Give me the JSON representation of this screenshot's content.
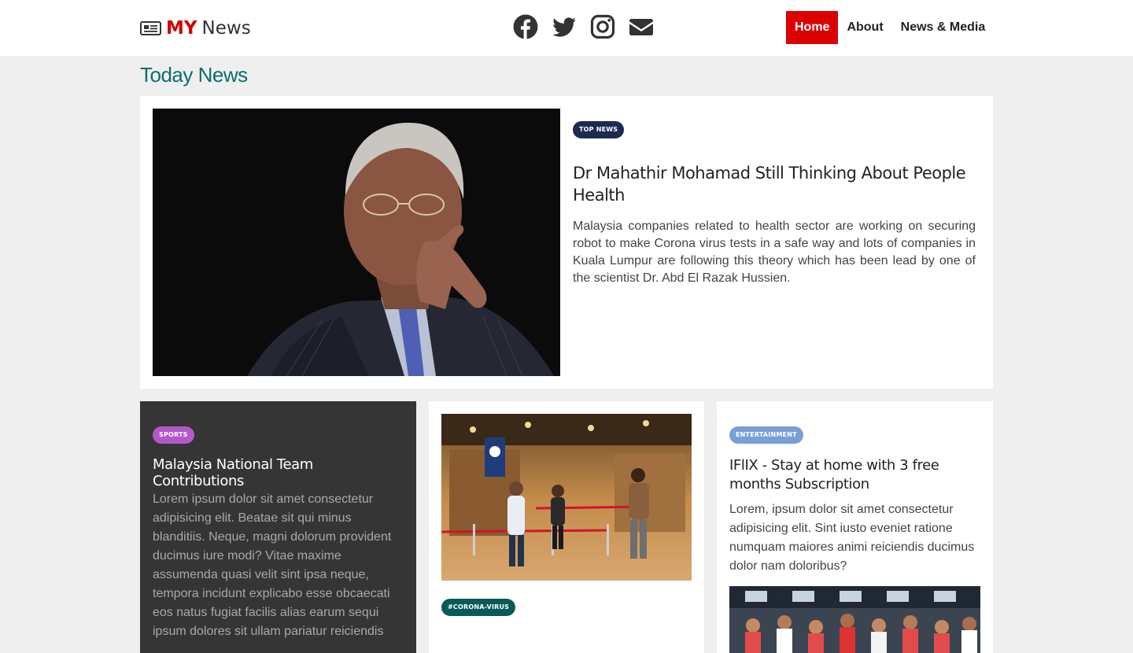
{
  "header": {
    "brand_my": "MY",
    "brand_news": "News",
    "socials": [
      "facebook-icon",
      "twitter-icon",
      "instagram-icon",
      "envelope-icon"
    ],
    "nav": [
      {
        "label": "Home",
        "active": true
      },
      {
        "label": "About",
        "active": false
      },
      {
        "label": "News & Media",
        "active": false
      }
    ]
  },
  "section_title": "Today News",
  "featured": {
    "badge": "TOP NEWS",
    "title": "Dr Mahathir Mohamad Still Thinking About People Health",
    "text": "Malaysia companies related to health sector are working on securing robot to make Corona virus tests in a safe way and lots of companies in Kuala Lumpur are following this theory which has been lead by one of the scientist Dr. Abd El Razak Hussien."
  },
  "cards": {
    "sports": {
      "badge": "SPORTS",
      "title": "Malaysia National Team Contributions",
      "text": "Lorem ipsum dolor sit amet consectetur adipisicing elit. Beatae sit qui minus blanditiis. Neque, magni dolorum provident ducimus iure modi? Vitae maxime assumenda quasi velit sint ipsa neque, tempora incidunt explicabo esse obcaecati eos natus fugiat facilis alias earum sequi ipsum dolores sit ullam pariatur reiciendis"
    },
    "corona": {
      "badge": "#CORONA-VIRUS"
    },
    "entertainment": {
      "badge": "ENTERTAINMENT",
      "title": "IFlIX - Stay at home with 3 free months Subscription",
      "text": "Lorem, ipsum dolor sit amet consectetur adipisicing elit. Sint iusto eveniet ratione numquam maiores animi reiciendis ducimus dolor nam doloribus?"
    }
  },
  "colors": {
    "accent_red": "#dd0000",
    "title_teal": "#0b6e6e",
    "badge_top": "#1e2a52",
    "badge_sports": "#b258c8",
    "badge_corona": "#0a5a5a",
    "badge_entertainment": "#7a9fd6"
  }
}
